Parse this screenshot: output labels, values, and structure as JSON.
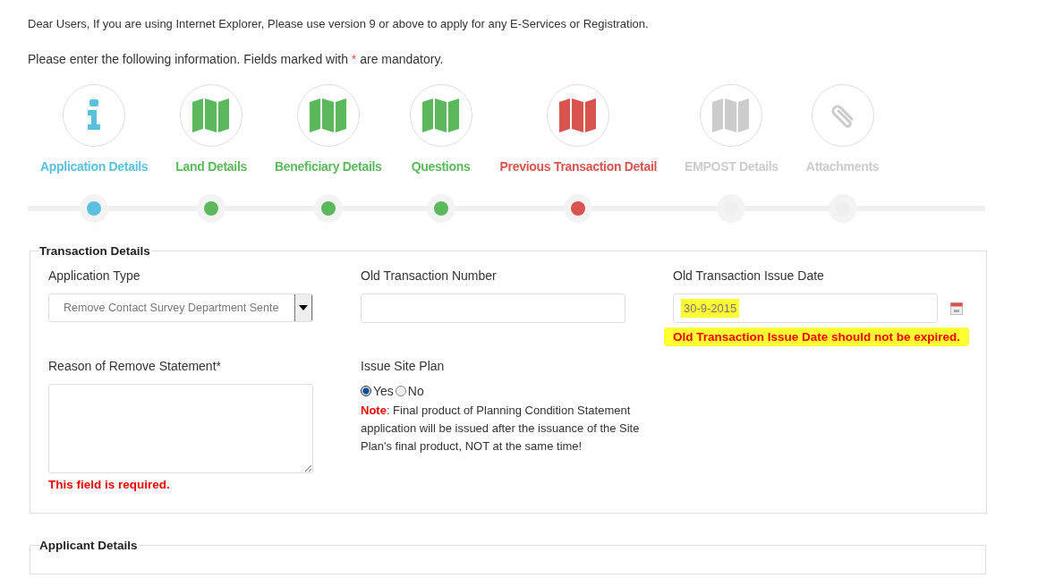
{
  "notice": "Dear Users, If you are using Internet Explorer, Please use version 9 or above to apply for any E-Services or Registration.",
  "instructions": {
    "before": "Please enter the following information. Fields marked with",
    "mark": "*",
    "after": "are mandatory."
  },
  "steps": [
    {
      "label": "Application Details",
      "color": "#5bc0de",
      "kind": "info"
    },
    {
      "label": "Land Details",
      "color": "#5cb85c",
      "kind": "map"
    },
    {
      "label": "Beneficiary Details",
      "color": "#5cb85c",
      "kind": "map"
    },
    {
      "label": "Questions",
      "color": "#5cb85c",
      "kind": "map"
    },
    {
      "label": "Previous Transaction Detail",
      "color": "#d9534f",
      "kind": "map"
    },
    {
      "label": "EMPOST Details",
      "color": "#cccccc",
      "kind": "map"
    },
    {
      "label": "Attachments",
      "color": "#cccccc",
      "kind": "paperclip"
    }
  ],
  "transaction_details": {
    "title": "Transaction Details",
    "application_type": {
      "label": "Application Type",
      "value": "Remove Contact Survey Department Sente"
    },
    "old_transaction_number": {
      "label": "Old Transaction Number"
    },
    "old_transaction_issue_date": {
      "label": "Old Transaction Issue Date",
      "value": "30-9-2015",
      "highlighted": true,
      "error": "Old Transaction Issue Date should not be expired.",
      "error_highlighted": true
    },
    "reason": {
      "label": "Reason of Remove Statement*",
      "error": "This field is required."
    },
    "issue_site_plan": {
      "label": "Issue Site Plan",
      "options": [
        {
          "label": "Yes",
          "selected": true
        },
        {
          "label": "No",
          "selected": false
        }
      ],
      "note_label": "Note",
      "note": ": Final product of Planning Condition Statement application will be issued after the issuance of the Site Plan's final product, NOT at the same time!"
    }
  },
  "applicant_details": {
    "title": "Applicant Details"
  }
}
